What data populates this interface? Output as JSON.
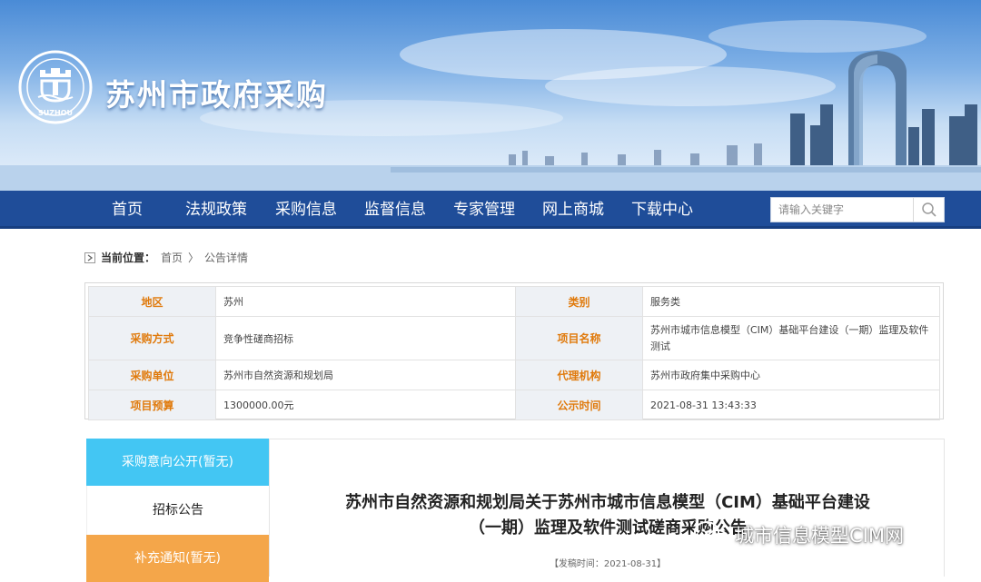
{
  "site": {
    "title": "苏州市政府采购",
    "logo_text": "SUZHOU"
  },
  "nav": {
    "items": [
      "首页",
      "法规政策",
      "采购信息",
      "监督信息",
      "专家管理",
      "网上商城",
      "下载中心"
    ],
    "search_placeholder": "请输入关键字"
  },
  "breadcrumb": {
    "label": "当前位置：",
    "home": "首页",
    "sep": "〉",
    "current": "公告详情"
  },
  "info": {
    "rows": [
      {
        "l1": "地区",
        "v1": "苏州",
        "l2": "类别",
        "v2": "服务类"
      },
      {
        "l1": "采购方式",
        "v1": "竞争性磋商招标",
        "l2": "项目名称",
        "v2": "苏州市城市信息模型（CIM）基础平台建设（一期）监理及软件测试"
      },
      {
        "l1": "采购单位",
        "v1": "苏州市自然资源和规划局",
        "l2": "代理机构",
        "v2": "苏州市政府集中采购中心"
      },
      {
        "l1": "项目预算",
        "v1": "1300000.00元",
        "l2": "公示时间",
        "v2": "2021-08-31 13:43:33"
      }
    ]
  },
  "tabs": [
    "采购意向公开(暂无)",
    "招标公告",
    "补充通知(暂无)"
  ],
  "document": {
    "title_line1": "苏州市自然资源和规划局关于苏州市城市信息模型（CIM）基础平台建设",
    "title_line2": "（一期）监理及软件测试磋商采购公告",
    "publish_time": "【发稿时间：2021-08-31】"
  },
  "watermark": {
    "text": "城市信息模型CIM网"
  },
  "colors": {
    "nav": "#1f4d99",
    "label": "#e07a0c",
    "tab_active": "#43c6f3",
    "tab_supplement": "#f4a64a"
  }
}
